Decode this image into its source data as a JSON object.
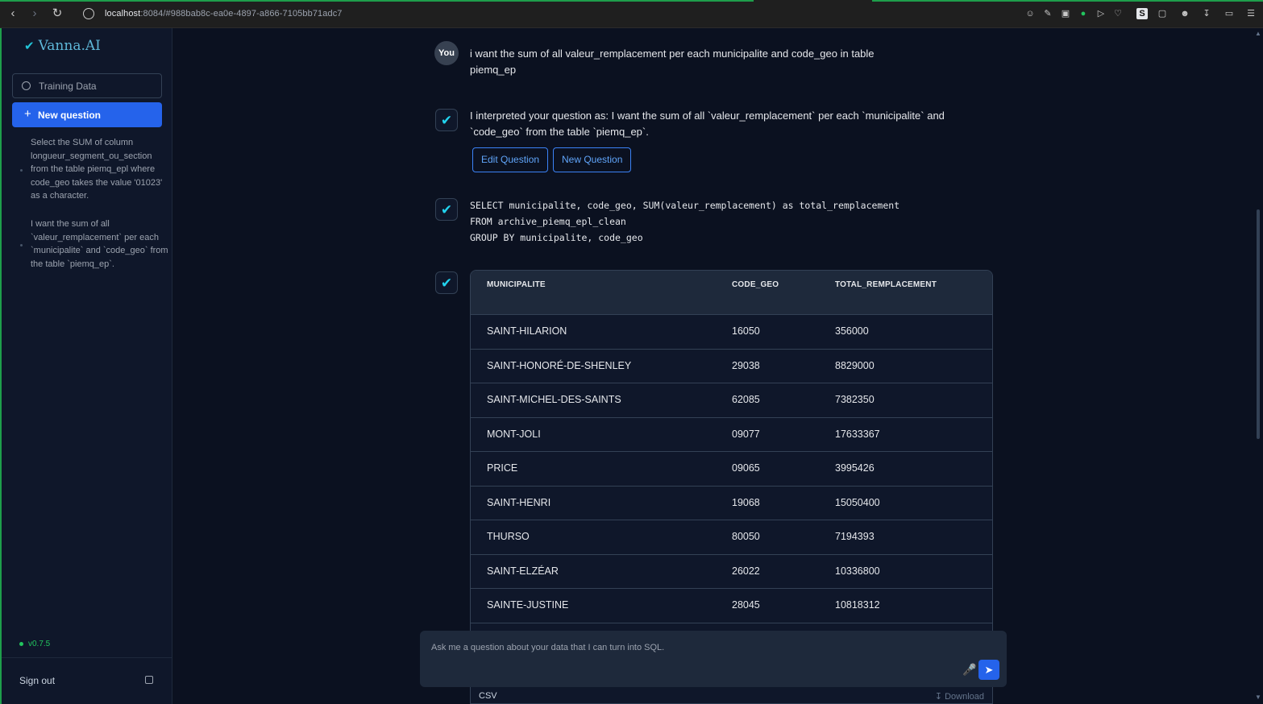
{
  "browser": {
    "url_host": "localhost",
    "url_rest": ":8084/#988bab8c-ea0e-4897-a866-7105bb71adc7"
  },
  "sidebar": {
    "brand": "Vanna.AI",
    "training_label": "Training Data",
    "new_question_label": "New question",
    "history": [
      "Select the SUM of column longueur_segment_ou_section from the table piemq_epl where code_geo takes the value '01023' as a character.",
      "I want the sum of all `valeur_remplacement` per each `municipalite` and `code_geo` from the table `piemq_ep`."
    ],
    "version": "v0.7.5",
    "signout_label": "Sign out"
  },
  "chat": {
    "you_label": "You",
    "user_question": "i want the sum of all valeur_remplacement per each municipalite and code_geo in table piemq_ep",
    "interpretation": "I interpreted your question as:  I want the sum of all `valeur_remplacement` per each `municipalite` and `code_geo` from the table `piemq_ep`.",
    "edit_button": "Edit Question",
    "new_button": "New Question",
    "sql": "SELECT municipalite, code_geo, SUM(valeur_remplacement) as total_remplacement\nFROM archive_piemq_epl_clean\nGROUP BY municipalite, code_geo",
    "table": {
      "headers": [
        "MUNICIPALITE",
        "CODE_GEO",
        "TOTAL_REMPLACEMENT"
      ],
      "rows": [
        [
          "SAINT-HILARION",
          "16050",
          "356000"
        ],
        [
          "SAINT-HONORÉ-DE-SHENLEY",
          "29038",
          "8829000"
        ],
        [
          "SAINT-MICHEL-DES-SAINTS",
          "62085",
          "7382350"
        ],
        [
          "MONT-JOLI",
          "09077",
          "17633367"
        ],
        [
          "PRICE",
          "09065",
          "3995426"
        ],
        [
          "SAINT-HENRI",
          "19068",
          "15050400"
        ],
        [
          "THURSO",
          "80050",
          "7194393"
        ],
        [
          "SAINT-ELZÉAR",
          "26022",
          "10336800"
        ],
        [
          "SAINTE-JUSTINE",
          "28045",
          "10818312"
        ]
      ],
      "csv_label": "CSV",
      "download_label": "Download"
    },
    "input_placeholder": "Ask me a question about your data that I can turn into SQL."
  }
}
